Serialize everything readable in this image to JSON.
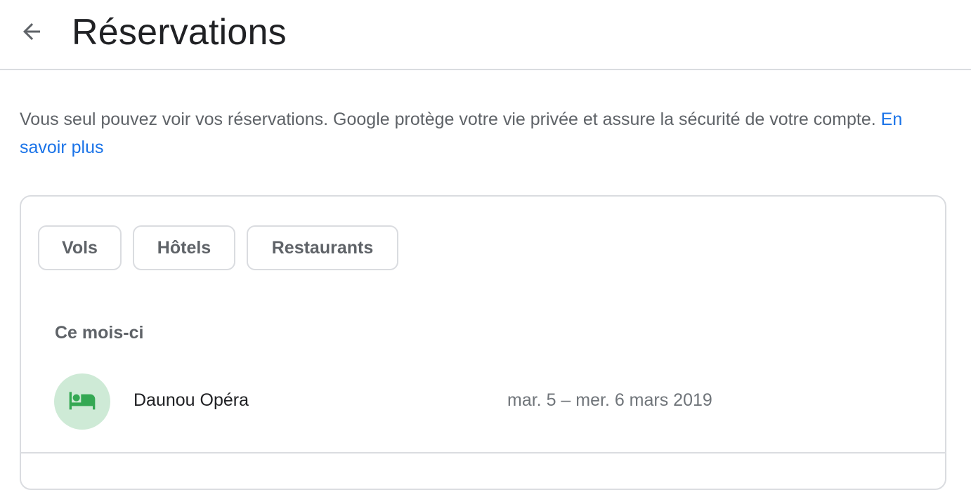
{
  "header": {
    "back_icon": "arrow-left-icon",
    "title": "Réservations"
  },
  "privacy": {
    "text": "Vous seul pouvez voir vos réservations. Google protège votre vie privée et assure la sécurité de votre compte.",
    "link_label": "En savoir plus"
  },
  "filters": {
    "chips": [
      {
        "label": "Vols"
      },
      {
        "label": "Hôtels"
      },
      {
        "label": "Restaurants"
      }
    ]
  },
  "sections": [
    {
      "title": "Ce mois-ci",
      "items": [
        {
          "icon": "hotel-bed-icon",
          "name": "Daunou Opéra",
          "dates": "mar. 5 – mer. 6 mars 2019"
        }
      ]
    }
  ],
  "colors": {
    "link": "#1a73e8",
    "avatar_bg": "#ceead6",
    "hotel_icon": "#34a853",
    "border": "#dadce0"
  }
}
